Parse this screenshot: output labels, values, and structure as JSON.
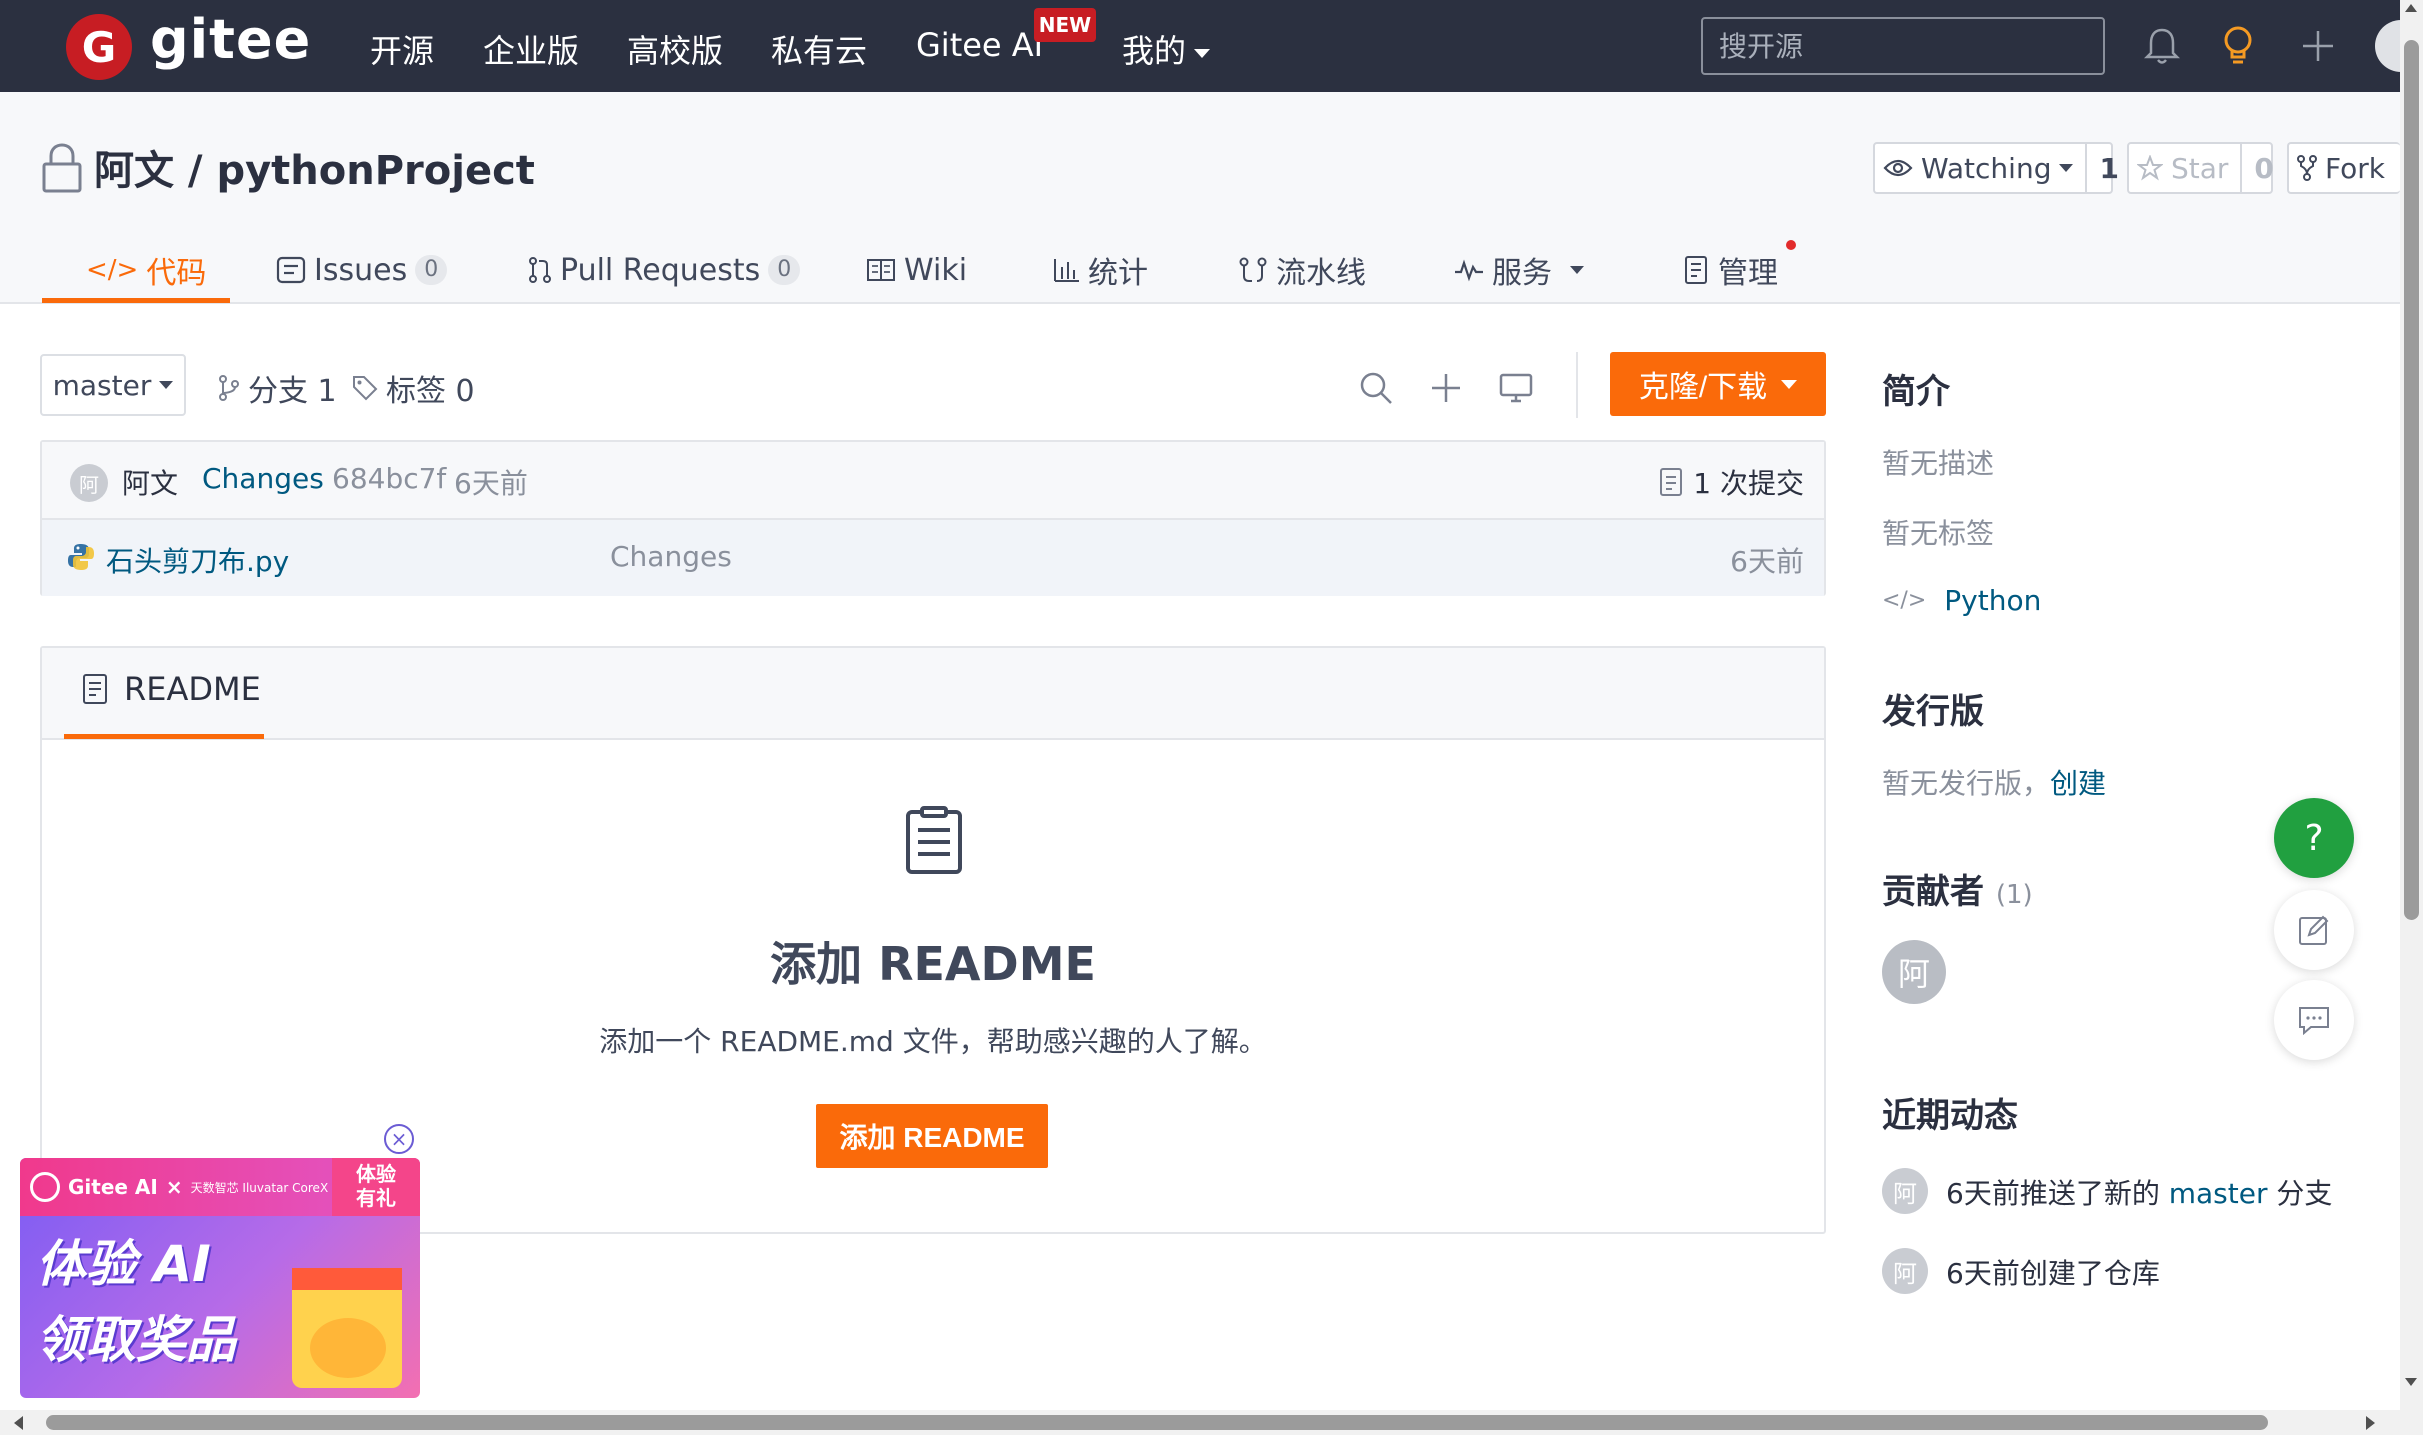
{
  "navbar": {
    "logo_letter": "G",
    "logo_text": "gitee",
    "items": [
      "开源",
      "企业版",
      "高校版",
      "私有云",
      "Gitee AI",
      "我的"
    ],
    "new_badge": "NEW",
    "search_placeholder": "搜开源"
  },
  "repo": {
    "owner": "阿文",
    "separator": " / ",
    "name": "pythonProject",
    "watching_label": "Watching",
    "watching_count": "1",
    "star_label": "Star",
    "star_count": "0",
    "fork_label": "Fork"
  },
  "tabs": [
    {
      "label": "代码",
      "icon": "code-icon"
    },
    {
      "label": "Issues",
      "icon": "issues-icon",
      "count": "0"
    },
    {
      "label": "Pull Requests",
      "icon": "pull-request-icon",
      "count": "0"
    },
    {
      "label": "Wiki",
      "icon": "wiki-icon"
    },
    {
      "label": "统计",
      "icon": "stats-icon"
    },
    {
      "label": "流水线",
      "icon": "pipeline-icon"
    },
    {
      "label": "服务",
      "icon": "service-icon"
    },
    {
      "label": "管理",
      "icon": "manage-icon"
    }
  ],
  "toolbar": {
    "branch": "master",
    "branches_label": "分支 1",
    "tags_label": "标签 0",
    "clone_label": "克隆/下载"
  },
  "commit": {
    "avatar_text": "阿",
    "author": "阿文",
    "message": "Changes",
    "hash": "684bc7f",
    "time": "6天前",
    "count_label": "1 次提交"
  },
  "files": [
    {
      "name": "石头剪刀布.py",
      "message": "Changes",
      "time": "6天前",
      "icon": "python-icon"
    }
  ],
  "readme": {
    "tab_label": "README",
    "title": "添加 README",
    "description": "添加一个 README.md 文件，帮助感兴趣的人了解。",
    "button": "添加 README"
  },
  "sidebar": {
    "intro_heading": "简介",
    "no_description": "暂无描述",
    "no_tags": "暂无标签",
    "language": "Python",
    "releases_heading": "发行版",
    "no_releases": "暂无发行版，",
    "create_link": "创建",
    "contributors_heading": "贡献者",
    "contributors_count": "(1)",
    "contributor_avatar": "阿",
    "activity_heading": "近期动态",
    "activities": [
      {
        "avatar": "阿",
        "prefix": "6天前推送了新的 ",
        "link": "master",
        "suffix": " 分支"
      },
      {
        "avatar": "阿",
        "prefix": "6天前创建了仓库",
        "link": "",
        "suffix": ""
      }
    ]
  },
  "float_buttons": {
    "help": "?"
  },
  "ad": {
    "brand": "Gitee AI",
    "cross": "×",
    "partner": "天数智芯 Iluvatar CoreX",
    "gift_line1": "体验",
    "gift_line2": "有礼",
    "line1": "体验 AI",
    "line2": "领取奖品",
    "close": "×"
  },
  "colors": {
    "navbar_bg": "#2b3040",
    "accent": "#fa6a0a",
    "brand_red": "#c71d23",
    "link": "#005980",
    "help_green": "#21a040"
  }
}
